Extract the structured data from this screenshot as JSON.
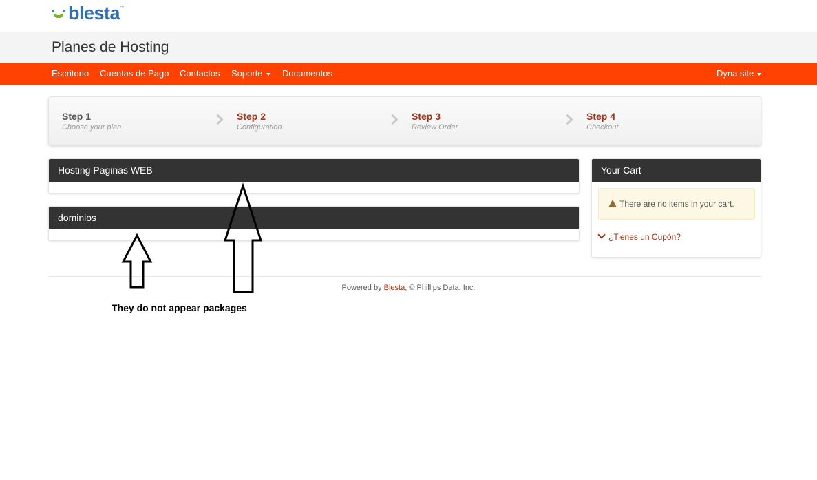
{
  "brand": {
    "name": "blesta",
    "tm": "™"
  },
  "page_title": "Planes de Hosting",
  "nav": {
    "items": [
      "Escritorio",
      "Cuentas de Pago",
      "Contactos",
      "Soporte",
      "Documentos"
    ],
    "user": "Dyna site"
  },
  "steps": [
    {
      "name": "Step 1",
      "desc": "Choose your plan",
      "color": "#555555"
    },
    {
      "name": "Step 2",
      "desc": "Configuration",
      "color": "#a33315"
    },
    {
      "name": "Step 3",
      "desc": "Review Order",
      "color": "#a33315"
    },
    {
      "name": "Step 4",
      "desc": "Checkout",
      "color": "#a33315"
    }
  ],
  "groups": [
    {
      "title": "Hosting Paginas WEB"
    },
    {
      "title": "dominios"
    }
  ],
  "cart": {
    "title": "Your Cart",
    "empty_message": "There are no items in your cart.",
    "coupon_link": "¿Tienes un Cupón?"
  },
  "footer": {
    "prefix": "Powered by ",
    "link": "Blesta",
    "suffix": ", © Phillips Data, Inc."
  },
  "annotation": "They do not appear packages",
  "colors": {
    "nav_bg": "#ff4200",
    "panel_head": "#333333",
    "link": "#a33315"
  }
}
